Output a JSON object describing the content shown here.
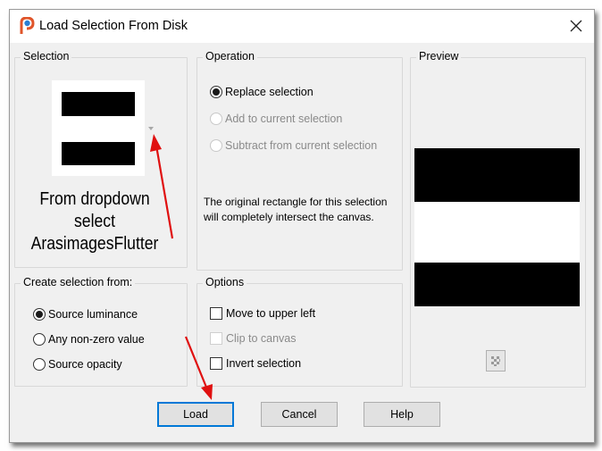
{
  "window": {
    "title": "Load Selection From Disk",
    "app_icon": "paintshop-pro-icon",
    "close_icon": "close-icon"
  },
  "selection_group": {
    "legend": "Selection",
    "dropdown_icon": "chevron-down-icon",
    "annotation_lines": [
      "From dropdown",
      "select",
      "ArasimagesFlutter"
    ]
  },
  "operation_group": {
    "legend": "Operation",
    "options": [
      {
        "label": "Replace selection",
        "checked": true,
        "enabled": true
      },
      {
        "label": "Add to current selection",
        "checked": false,
        "enabled": false
      },
      {
        "label": "Subtract from current selection",
        "checked": false,
        "enabled": false
      }
    ],
    "message": "The original rectangle for this selection will completely intersect the canvas."
  },
  "preview_group": {
    "legend": "Preview",
    "transparency_icon": "checkerboard-icon"
  },
  "create_from_group": {
    "legend": "Create selection from:",
    "options": [
      {
        "label": "Source luminance",
        "checked": true
      },
      {
        "label": "Any non-zero value",
        "checked": false
      },
      {
        "label": "Source opacity",
        "checked": false
      }
    ]
  },
  "options_group": {
    "legend": "Options",
    "checkboxes": [
      {
        "label": "Move to upper left",
        "checked": false,
        "enabled": true
      },
      {
        "label": "Clip to canvas",
        "checked": false,
        "enabled": false
      },
      {
        "label": "Invert selection",
        "checked": false,
        "enabled": true
      }
    ]
  },
  "buttons": {
    "load": "Load",
    "cancel": "Cancel",
    "help": "Help"
  },
  "colors": {
    "accent": "#0078d7",
    "annotation_arrow": "#e01010",
    "dialog_bg": "#f0f0f0"
  }
}
